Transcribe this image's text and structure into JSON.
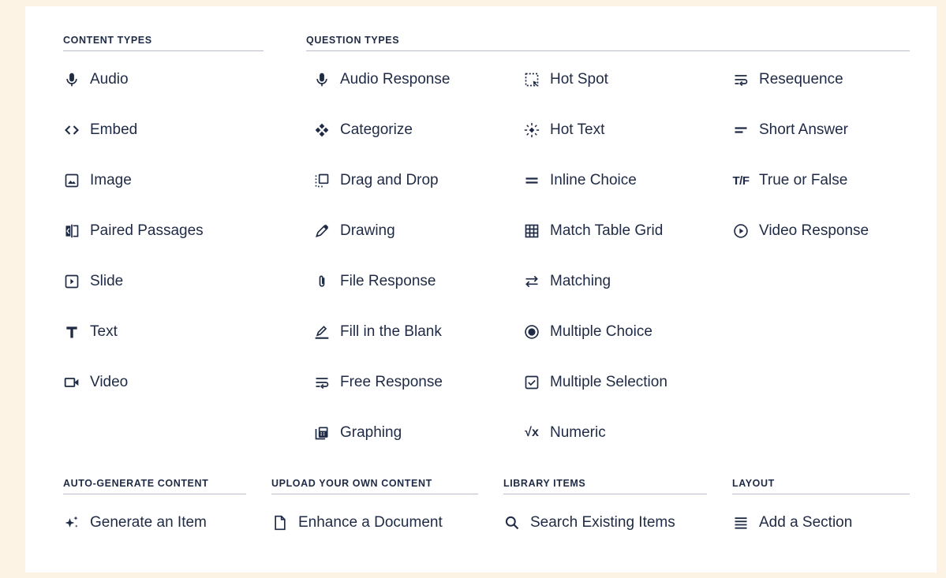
{
  "sections": {
    "content_types": {
      "heading": "CONTENT TYPES",
      "items": [
        {
          "label": "Audio",
          "icon": "microphone-icon"
        },
        {
          "label": "Embed",
          "icon": "code-icon"
        },
        {
          "label": "Image",
          "icon": "image-icon"
        },
        {
          "label": "Paired Passages",
          "icon": "paired-passages-icon"
        },
        {
          "label": "Slide",
          "icon": "slide-icon"
        },
        {
          "label": "Text",
          "icon": "text-icon"
        },
        {
          "label": "Video",
          "icon": "video-camera-icon"
        }
      ]
    },
    "question_types": {
      "heading": "QUESTION TYPES",
      "col1": [
        {
          "label": "Audio Response",
          "icon": "microphone-icon"
        },
        {
          "label": "Categorize",
          "icon": "categorize-icon"
        },
        {
          "label": "Drag and Drop",
          "icon": "drag-drop-icon"
        },
        {
          "label": "Drawing",
          "icon": "pencil-icon"
        },
        {
          "label": "File Response",
          "icon": "paperclip-icon"
        },
        {
          "label": "Fill in the Blank",
          "icon": "fill-blank-icon"
        },
        {
          "label": "Free Response",
          "icon": "text-wrap-icon"
        },
        {
          "label": "Graphing",
          "icon": "graphing-icon"
        }
      ],
      "col2": [
        {
          "label": "Hot Spot",
          "icon": "hot-spot-icon"
        },
        {
          "label": "Hot Text",
          "icon": "hot-text-icon"
        },
        {
          "label": "Inline Choice",
          "icon": "inline-choice-icon"
        },
        {
          "label": "Match Table Grid",
          "icon": "table-grid-icon"
        },
        {
          "label": "Matching",
          "icon": "swap-arrows-icon"
        },
        {
          "label": "Multiple Choice",
          "icon": "radio-selected-icon"
        },
        {
          "label": "Multiple Selection",
          "icon": "checkbox-checked-icon"
        },
        {
          "label": "Numeric",
          "icon": "square-root-icon",
          "glyph": "√x"
        }
      ],
      "col3": [
        {
          "label": "Resequence",
          "icon": "text-wrap-icon"
        },
        {
          "label": "Short Answer",
          "icon": "short-answer-icon"
        },
        {
          "label": "True or False",
          "icon": "true-false-icon",
          "glyph": "T/F"
        },
        {
          "label": "Video Response",
          "icon": "play-circle-icon"
        }
      ]
    },
    "auto_generate": {
      "heading": "AUTO-GENERATE CONTENT",
      "items": [
        {
          "label": "Generate an Item",
          "icon": "sparkle-icon"
        }
      ]
    },
    "upload": {
      "heading": "UPLOAD YOUR OWN CONTENT",
      "items": [
        {
          "label": "Enhance a Document",
          "icon": "document-icon"
        }
      ]
    },
    "library": {
      "heading": "LIBRARY ITEMS",
      "items": [
        {
          "label": "Search Existing Items",
          "icon": "search-icon"
        }
      ]
    },
    "layout": {
      "heading": "LAYOUT",
      "items": [
        {
          "label": "Add a Section",
          "icon": "lines-icon"
        }
      ]
    }
  },
  "colors": {
    "text": "#1f2a44",
    "divider": "#b8bccb",
    "background": "#fdf3e4",
    "panel": "#ffffff"
  }
}
